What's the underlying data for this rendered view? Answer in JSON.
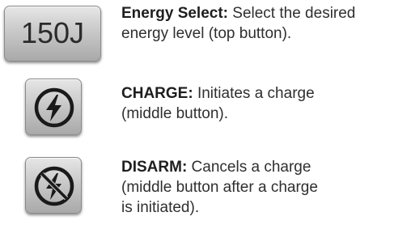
{
  "items": [
    {
      "button_label": "150J",
      "title": "Energy Select:",
      "line1": " Select the desired",
      "line2": "energy level (top button)."
    },
    {
      "button_icon": "lightning-bolt-icon",
      "title": "CHARGE:",
      "line1": " Initiates a charge",
      "line2": "(middle button)."
    },
    {
      "button_icon": "crossed-lightning-bolt-icon",
      "title": "DISARM:",
      "line1": " Cancels a charge",
      "line2": "(middle button after a charge",
      "line3": "is initiated)."
    }
  ]
}
